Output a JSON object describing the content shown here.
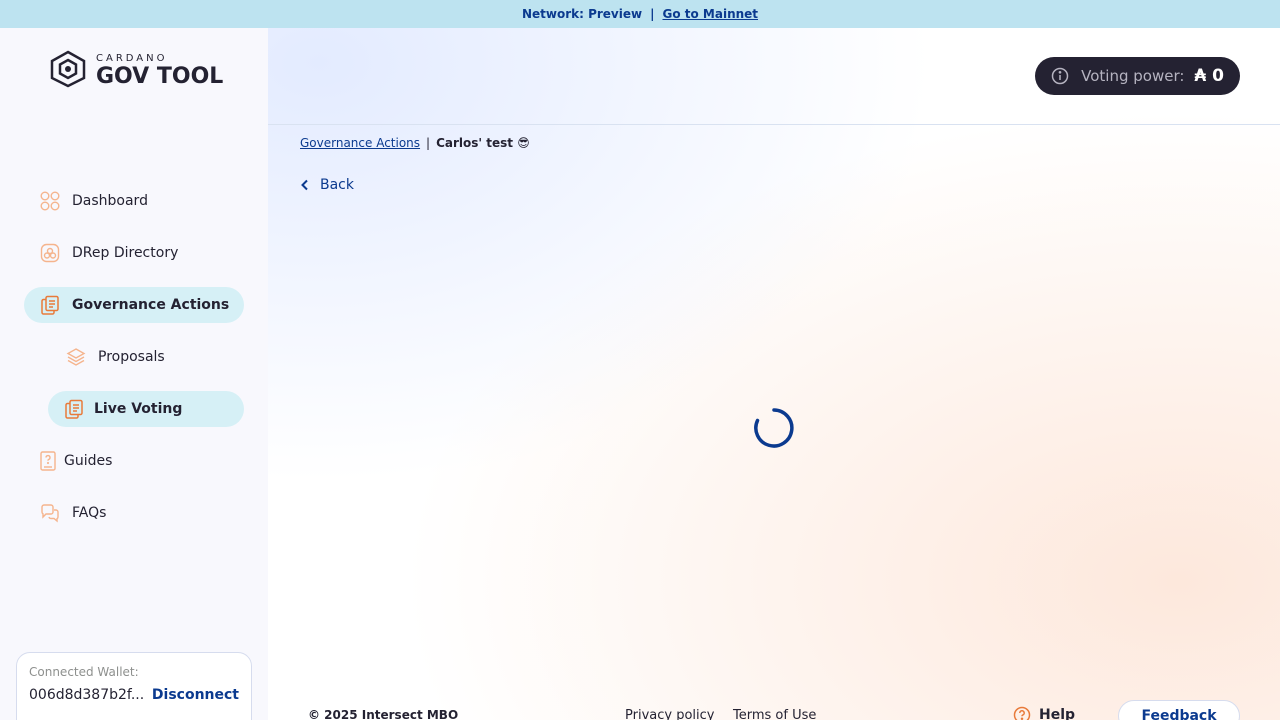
{
  "network_bar": {
    "text": "Network: Preview",
    "separator": "|",
    "link": "Go to Mainnet"
  },
  "logo": {
    "small": "CARDANO",
    "big": "GOV TOOL"
  },
  "sidebar": {
    "items": [
      {
        "label": "Dashboard",
        "icon": "dashboard-icon"
      },
      {
        "label": "DRep Directory",
        "icon": "drep-directory-icon"
      },
      {
        "label": "Governance Actions",
        "icon": "governance-actions-icon",
        "active": true
      },
      {
        "label": "Proposals",
        "icon": "proposals-icon"
      },
      {
        "label": "Live Voting",
        "icon": "live-voting-icon",
        "active": true
      },
      {
        "label": "Guides",
        "icon": "guides-icon"
      },
      {
        "label": "FAQs",
        "icon": "faqs-icon"
      }
    ]
  },
  "wallet": {
    "label": "Connected Wallet:",
    "address": "006d8d387b2f...",
    "disconnect": "Disconnect"
  },
  "voting_power": {
    "label": "Voting power:",
    "value": "₳ 0"
  },
  "breadcrumb": {
    "link": "Governance Actions",
    "divider": "|",
    "current": "Carlos' test 😎"
  },
  "back": {
    "label": "Back"
  },
  "footer": {
    "copyright": "© 2025 Intersect MBO",
    "privacy": "Privacy policy",
    "terms": "Terms of Use",
    "help": "Help",
    "feedback": "Feedback"
  },
  "colors": {
    "accent": "#0b3a8f",
    "active_bg": "#d6f0f6",
    "icon_orange": "#f08a4b",
    "network_bar": "#bde3f0",
    "dark": "#242232"
  }
}
